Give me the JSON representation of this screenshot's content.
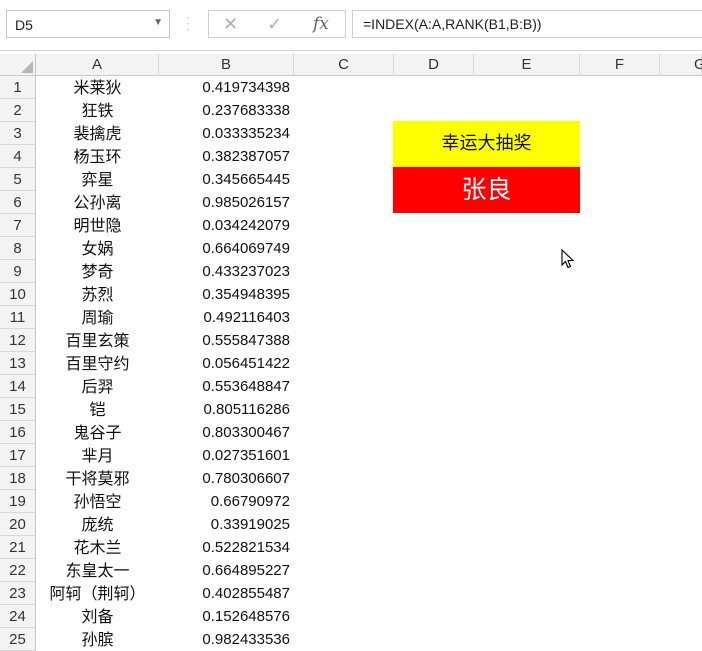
{
  "name_box": "D5",
  "formula": "=INDEX(A:A,RANK(B1,B:B))",
  "icons": {
    "cancel": "x-icon",
    "confirm": "check-icon",
    "function": "fx-icon"
  },
  "fx_label": "fx",
  "columns": [
    "A",
    "B",
    "C",
    "D",
    "E",
    "F",
    "G"
  ],
  "rows": [
    {
      "num": "1",
      "name": "米莱狄",
      "value": "0.419734398"
    },
    {
      "num": "2",
      "name": "狂铁",
      "value": "0.237683338"
    },
    {
      "num": "3",
      "name": "裴擒虎",
      "value": "0.033335234"
    },
    {
      "num": "4",
      "name": "杨玉环",
      "value": "0.382387057"
    },
    {
      "num": "5",
      "name": "弈星",
      "value": "0.345665445"
    },
    {
      "num": "6",
      "name": "公孙离",
      "value": "0.985026157"
    },
    {
      "num": "7",
      "name": "明世隐",
      "value": "0.034242079"
    },
    {
      "num": "8",
      "name": "女娲",
      "value": "0.664069749"
    },
    {
      "num": "9",
      "name": "梦奇",
      "value": "0.433237023"
    },
    {
      "num": "10",
      "name": "苏烈",
      "value": "0.354948395"
    },
    {
      "num": "11",
      "name": "周瑜",
      "value": "0.492116403"
    },
    {
      "num": "12",
      "name": "百里玄策",
      "value": "0.555847388"
    },
    {
      "num": "13",
      "name": "百里守约",
      "value": "0.056451422"
    },
    {
      "num": "14",
      "name": "后羿",
      "value": "0.553648847"
    },
    {
      "num": "15",
      "name": "铠",
      "value": "0.805116286"
    },
    {
      "num": "16",
      "name": "鬼谷子",
      "value": "0.803300467"
    },
    {
      "num": "17",
      "name": "芈月",
      "value": "0.027351601"
    },
    {
      "num": "18",
      "name": "干将莫邪",
      "value": "0.780306607"
    },
    {
      "num": "19",
      "name": "孙悟空",
      "value": "0.66790972"
    },
    {
      "num": "20",
      "name": "庞统",
      "value": "0.33919025"
    },
    {
      "num": "21",
      "name": "花木兰",
      "value": "0.522821534"
    },
    {
      "num": "22",
      "name": "东皇太一",
      "value": "0.664895227"
    },
    {
      "num": "23",
      "name": "阿轲（荆轲）",
      "value": "0.402855487"
    },
    {
      "num": "24",
      "name": "刘备",
      "value": "0.152648576"
    },
    {
      "num": "25",
      "name": "孙膑",
      "value": "0.982433536"
    }
  ],
  "lottery": {
    "title": "幸运大抽奖",
    "winner": "张良"
  },
  "colors": {
    "title_bg": "#ffff00",
    "winner_bg": "#ff0000",
    "winner_text": "#ffffff"
  }
}
